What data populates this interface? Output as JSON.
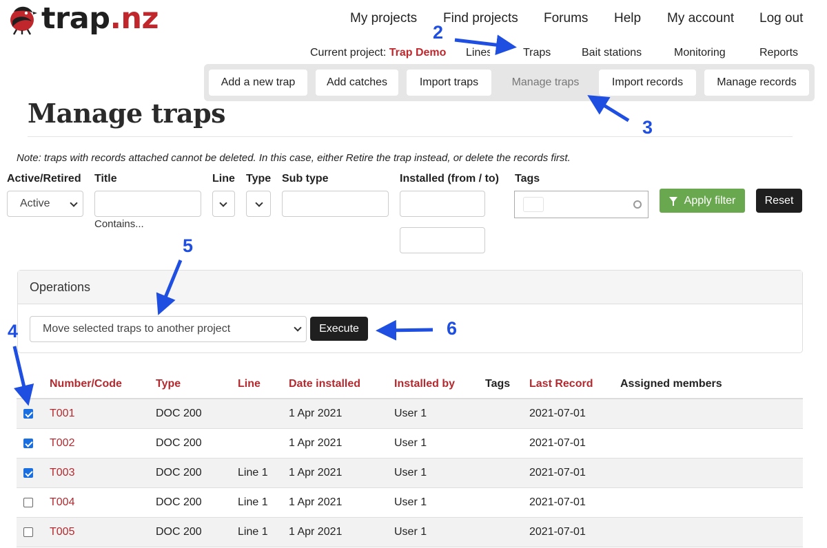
{
  "logo": {
    "brand": "trap",
    "tld": ".nz"
  },
  "nav": {
    "my_projects": "My projects",
    "find_projects": "Find projects",
    "forums": "Forums",
    "help": "Help",
    "my_account": "My account",
    "log_out": "Log out"
  },
  "subnav": {
    "current_project_label": "Current project:",
    "current_project_name": "Trap Demo",
    "lines": "Lines",
    "traps": "Traps",
    "bait_stations": "Bait stations",
    "monitoring": "Monitoring",
    "reports": "Reports"
  },
  "toolbar": {
    "add_trap": "Add a new trap",
    "add_catches": "Add catches",
    "import_traps": "Import traps",
    "manage_traps": "Manage traps",
    "import_records": "Import records",
    "manage_records": "Manage records"
  },
  "page_title": "Manage traps",
  "note": "Note: traps with records attached cannot be deleted. In this case, either Retire the trap instead, or delete the records first.",
  "filter": {
    "labels": {
      "active_retired": "Active/Retired",
      "title": "Title",
      "line": "Line",
      "type": "Type",
      "sub_type": "Sub type",
      "installed": "Installed (from / to)",
      "tags": "Tags"
    },
    "active_value": "Active",
    "contains_hint": "Contains...",
    "apply": "Apply filter",
    "reset": "Reset"
  },
  "operations": {
    "heading": "Operations",
    "selected_op": "Move selected traps to another project",
    "execute": "Execute"
  },
  "table": {
    "headers": {
      "number": "Number/Code",
      "type": "Type",
      "line": "Line",
      "date_installed": "Date installed",
      "installed_by": "Installed by",
      "tags": "Tags",
      "last_record": "Last Record",
      "assigned": "Assigned members"
    },
    "rows": [
      {
        "checked": true,
        "code": "T001",
        "type": "DOC 200",
        "line": "",
        "date": "1 Apr 2021",
        "by": "User 1",
        "last": "2021-07-01"
      },
      {
        "checked": true,
        "code": "T002",
        "type": "DOC 200",
        "line": "",
        "date": "1 Apr 2021",
        "by": "User 1",
        "last": "2021-07-01"
      },
      {
        "checked": true,
        "code": "T003",
        "type": "DOC 200",
        "line": "Line 1",
        "date": "1 Apr 2021",
        "by": "User 1",
        "last": "2021-07-01"
      },
      {
        "checked": false,
        "code": "T004",
        "type": "DOC 200",
        "line": "Line 1",
        "date": "1 Apr 2021",
        "by": "User 1",
        "last": "2021-07-01"
      },
      {
        "checked": false,
        "code": "T005",
        "type": "DOC 200",
        "line": "Line 1",
        "date": "1 Apr 2021",
        "by": "User 1",
        "last": "2021-07-01"
      }
    ]
  },
  "annotations": {
    "a2": "2",
    "a3": "3",
    "a4": "4",
    "a5": "5",
    "a6": "6"
  },
  "colors": {
    "brand_red": "#c0272d",
    "link_red": "#b22a2f",
    "annotation_blue": "#1f4fe0",
    "apply_green": "#6aa84f"
  }
}
